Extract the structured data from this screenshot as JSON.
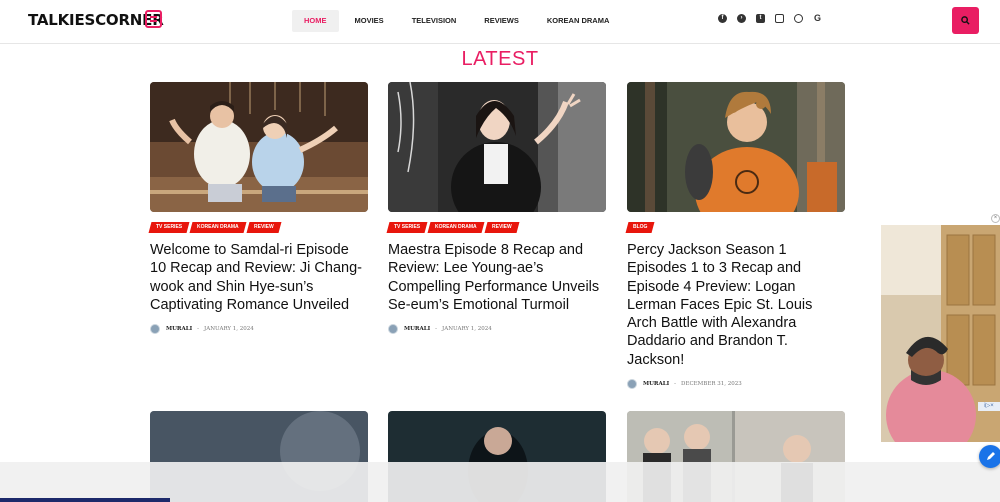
{
  "site": {
    "logo_main": "TALKIESCORNER",
    "nav": [
      "HOME",
      "MOVIES",
      "TELEVISION",
      "REVIEWS",
      "KOREAN DRAMA"
    ],
    "social_icons": [
      "facebook-icon",
      "telegram-icon",
      "twitter-icon",
      "instagram-icon",
      "whatsapp-icon",
      "google-icon"
    ],
    "accent": "#e91e63"
  },
  "section": {
    "title": "LATEST"
  },
  "cards": [
    {
      "tags": [
        "TV SERIES",
        "KOREAN DRAMA",
        "REVIEW"
      ],
      "title": "Welcome to Samdal-ri Episode 10 Recap and Review: Ji Chang-wook and Shin Hye-sun’s Captivating Romance Unveiled",
      "author": "MURALI",
      "date": "JANUARY 1, 2024"
    },
    {
      "tags": [
        "TV SERIES",
        "KOREAN DRAMA",
        "REVIEW"
      ],
      "title": "Maestra Episode 8 Recap and Review: Lee Young-ae’s Compelling Performance Unveils Se-eum’s Emotional Turmoil",
      "author": "MURALI",
      "date": "JANUARY 1, 2024"
    },
    {
      "tags": [
        "BLOG"
      ],
      "title": "Percy Jackson Season 1 Episodes 1 to 3 Recap and Episode 4 Preview: Logan Lerman Faces Epic St. Louis Arch Battle with Alexandra Daddario and Brandon T. Jackson!",
      "author": "MURALI",
      "date": "DECEMBER 31, 2023"
    }
  ]
}
